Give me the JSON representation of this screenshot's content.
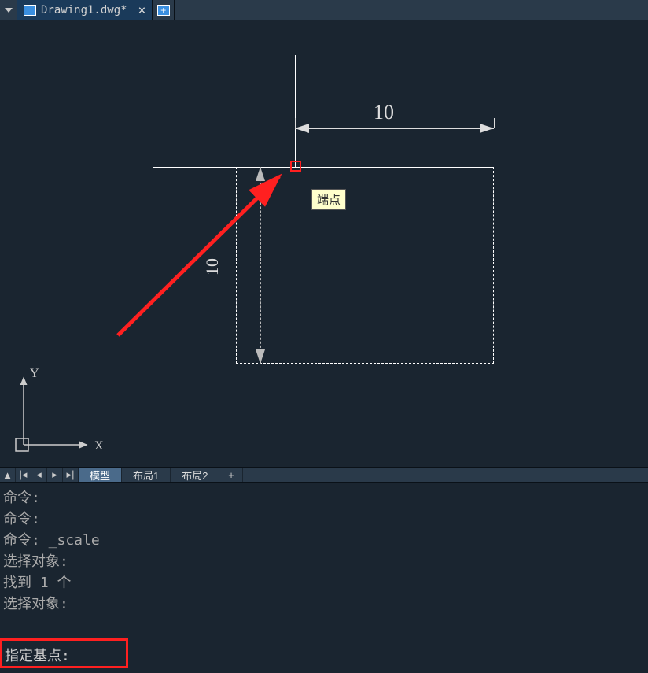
{
  "tabs": {
    "active": {
      "filename": "Drawing1.dwg*"
    }
  },
  "drawing": {
    "dim_horizontal": "10",
    "dim_vertical": "10",
    "snap_tooltip": "端点"
  },
  "ucs": {
    "x_label": "X",
    "y_label": "Y"
  },
  "layout": {
    "model": "模型",
    "layout1": "布局1",
    "layout2": "布局2",
    "add": "+"
  },
  "command_history": [
    "命令:",
    "命令:",
    "命令: _scale",
    "选择对象:",
    "找到 1 个",
    "选择对象:"
  ],
  "command_line": {
    "prompt": "指定基点:",
    "value": ""
  }
}
